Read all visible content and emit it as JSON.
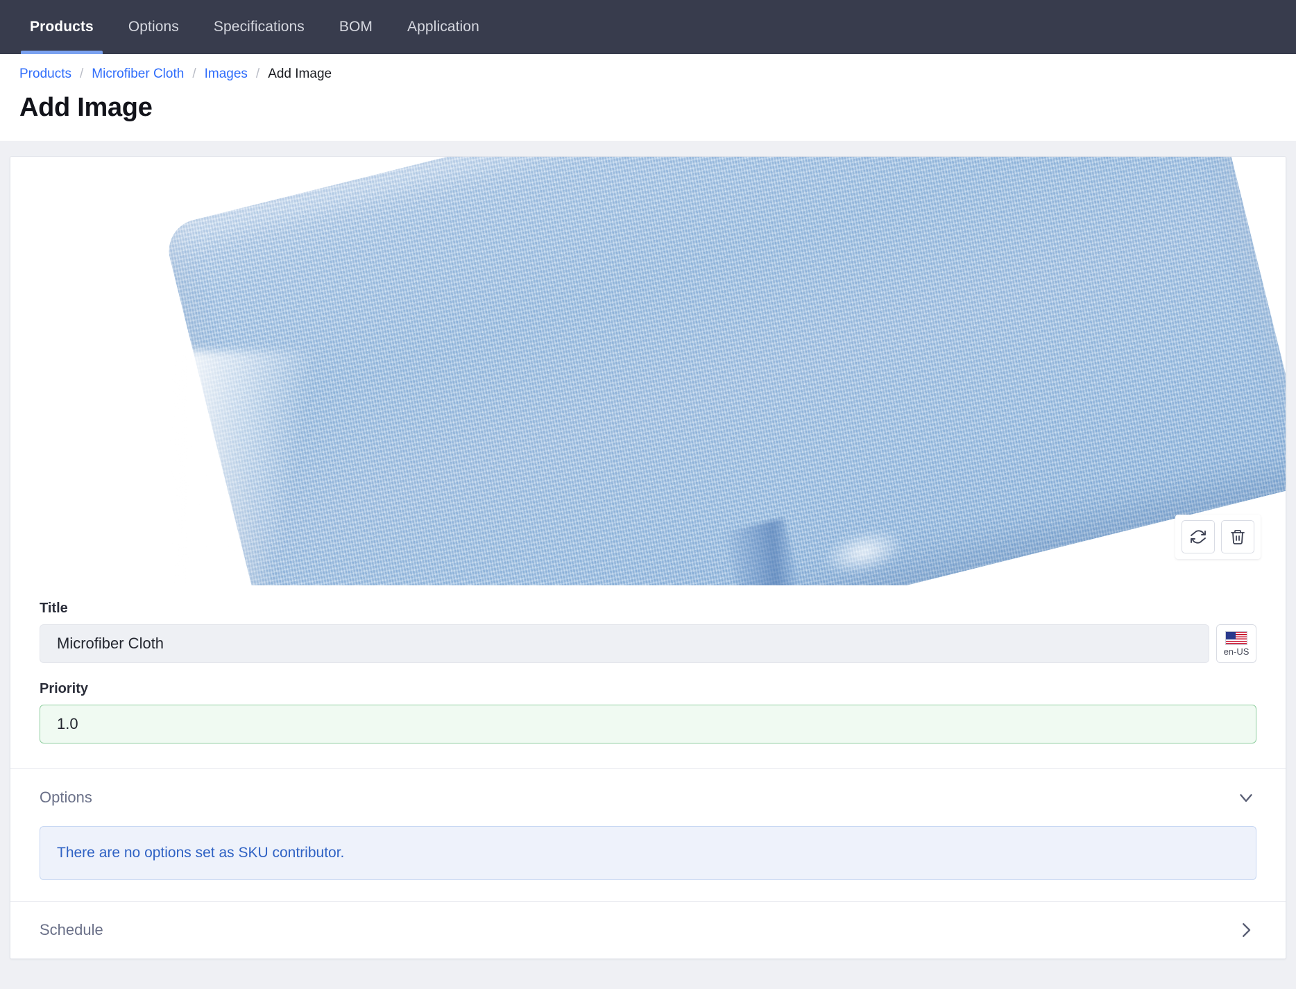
{
  "nav": {
    "items": [
      {
        "label": "Products",
        "active": true
      },
      {
        "label": "Options",
        "active": false
      },
      {
        "label": "Specifications",
        "active": false
      },
      {
        "label": "BOM",
        "active": false
      },
      {
        "label": "Application",
        "active": false
      }
    ],
    "background_color": "#383c4d",
    "active_indicator_color": "#7ba2f0"
  },
  "breadcrumb": {
    "items": [
      {
        "label": "Products",
        "is_link": true
      },
      {
        "label": "Microfiber Cloth",
        "is_link": true
      },
      {
        "label": "Images",
        "is_link": true
      },
      {
        "label": "Add Image",
        "is_link": false
      }
    ],
    "separator": "/",
    "link_color": "#2f6dfb"
  },
  "page": {
    "title": "Add Image"
  },
  "image_preview": {
    "alt_description": "Light blue folded microfiber cloth",
    "dominant_color": "#9dc0e2",
    "toolbar": {
      "refresh_label": "refresh-icon",
      "delete_label": "trash-icon"
    }
  },
  "form": {
    "title_field": {
      "label": "Title",
      "value": "Microfiber Cloth",
      "placeholder": "Title"
    },
    "language": {
      "code": "en-US",
      "flag": "us-flag-icon"
    },
    "priority_field": {
      "label": "Priority",
      "value": "1.0",
      "placeholder": "Priority",
      "border_color": "#8fce9f",
      "background_color": "#f0faf2"
    }
  },
  "sections": [
    {
      "title": "Options",
      "expanded": true,
      "chevron": "chevron-down-icon",
      "message": "There are no options set as SKU contributor.",
      "message_color": "#2f62c4"
    },
    {
      "title": "Schedule",
      "expanded": false,
      "chevron": "chevron-right-icon",
      "message": "",
      "message_color": ""
    }
  ]
}
